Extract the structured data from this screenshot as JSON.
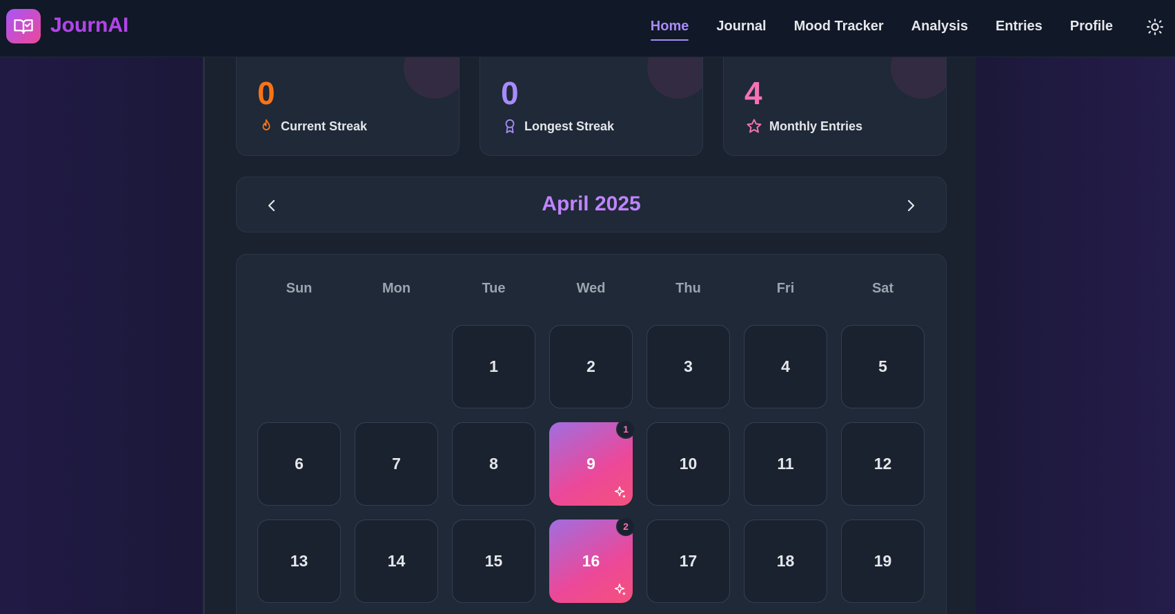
{
  "app": {
    "name": "JournAI"
  },
  "nav": {
    "links": [
      {
        "label": "Home",
        "active": true
      },
      {
        "label": "Journal",
        "active": false
      },
      {
        "label": "Mood Tracker",
        "active": false
      },
      {
        "label": "Analysis",
        "active": false
      },
      {
        "label": "Entries",
        "active": false
      },
      {
        "label": "Profile",
        "active": false
      }
    ]
  },
  "stats": [
    {
      "value": "0",
      "label": "Current Streak",
      "icon": "flame-icon",
      "color": "#f97316"
    },
    {
      "value": "0",
      "label": "Longest Streak",
      "icon": "award-icon",
      "color": "#a78bfa"
    },
    {
      "value": "4",
      "label": "Monthly Entries",
      "icon": "star-icon",
      "color": "#f472b6"
    }
  ],
  "calendar": {
    "month_label": "April 2025",
    "weekdays": [
      "Sun",
      "Mon",
      "Tue",
      "Wed",
      "Thu",
      "Fri",
      "Sat"
    ],
    "days": [
      {
        "day": "1"
      },
      {
        "day": "2"
      },
      {
        "day": "3"
      },
      {
        "day": "4"
      },
      {
        "day": "5"
      },
      {
        "day": "6"
      },
      {
        "day": "7"
      },
      {
        "day": "8"
      },
      {
        "day": "9",
        "entries": "1"
      },
      {
        "day": "10"
      },
      {
        "day": "11"
      },
      {
        "day": "12"
      },
      {
        "day": "13"
      },
      {
        "day": "14"
      },
      {
        "day": "15"
      },
      {
        "day": "16",
        "entries": "2"
      },
      {
        "day": "17"
      },
      {
        "day": "18"
      },
      {
        "day": "19"
      }
    ]
  },
  "colors": {
    "accent": "#a78bfa",
    "brand_gradient_start": "#a855f7",
    "brand_gradient_end": "#ec4899",
    "month_title": "#c084fc"
  }
}
